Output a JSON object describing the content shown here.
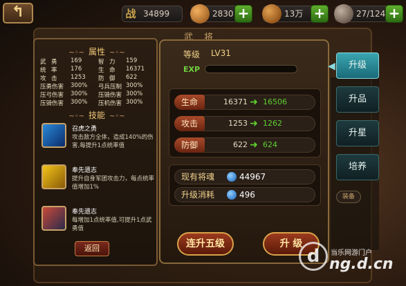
{
  "window": {
    "panel_title": "武 将"
  },
  "topbar": {
    "back_icon": "curved-back-arrow",
    "resources": [
      {
        "icon_text": "战",
        "value": "34899",
        "has_plus": false,
        "color": "#c9a24a"
      },
      {
        "icon_text": "",
        "value": "2830",
        "has_plus": true,
        "color": "#d08a3a"
      },
      {
        "icon_text": "",
        "value": "13万",
        "has_plus": true,
        "color": "#c0802a"
      },
      {
        "icon_text": "",
        "value": "27/124",
        "has_plus": true,
        "color": "#9a8a7a"
      }
    ]
  },
  "attributes": {
    "heading": "属性",
    "rows": [
      [
        "武",
        "勇",
        "169",
        "智",
        "力",
        "159"
      ],
      [
        "统",
        "率",
        "176",
        "生",
        "命",
        "16371"
      ],
      [
        "攻",
        "击",
        "1253",
        "防",
        "御",
        "622"
      ],
      [
        "压勇伤害",
        "300%",
        "弓兵压制",
        "300%"
      ],
      [
        "压弓伤害",
        "300%",
        "压骑伤害",
        "300%"
      ],
      [
        "压骑伤害",
        "300%",
        "压机伤害",
        "300%"
      ]
    ]
  },
  "skills": {
    "heading": "技能",
    "items": [
      {
        "name": "召虎之勇",
        "desc": "攻击敌方全体，造成140%的伤害,每提升1点统率值",
        "color1": "#2a8ad8",
        "color2": "#0a2a6a"
      },
      {
        "name": "奉先遗志",
        "desc": "提升自身军团攻击力，每点统率值增加1%",
        "color1": "#f2c41a",
        "color2": "#8a5a08"
      },
      {
        "name": "奉先遗志",
        "desc": "每增加1点统率值,可提升1点武勇值",
        "color1": "#c84a3a",
        "color2": "#2a2a4a"
      }
    ],
    "back_label": "返回"
  },
  "level": {
    "label": "等级",
    "value": "LV31",
    "exp_label": "EXP",
    "exp_fraction": 0
  },
  "stats": [
    {
      "label": "生命",
      "old": "16371",
      "new": "16506"
    },
    {
      "label": "攻击",
      "old": "1253",
      "new": "1262"
    },
    {
      "label": "防御",
      "old": "622",
      "new": "624"
    }
  ],
  "resources": [
    {
      "label": "现有将魂",
      "value": "44967"
    },
    {
      "label": "升级消耗",
      "value": "496"
    }
  ],
  "actions": {
    "upgrade_five": "连升五级",
    "upgrade": "升 级"
  },
  "tabs": [
    {
      "label": "升级",
      "active": true
    },
    {
      "label": "升品",
      "active": false
    },
    {
      "label": "升星",
      "active": false
    },
    {
      "label": "培养",
      "active": false
    }
  ],
  "equip_tag": "装备",
  "watermark": {
    "top_text": "当乐网游门户",
    "url": "ng.d.cn",
    "logo_glyph": "d"
  }
}
